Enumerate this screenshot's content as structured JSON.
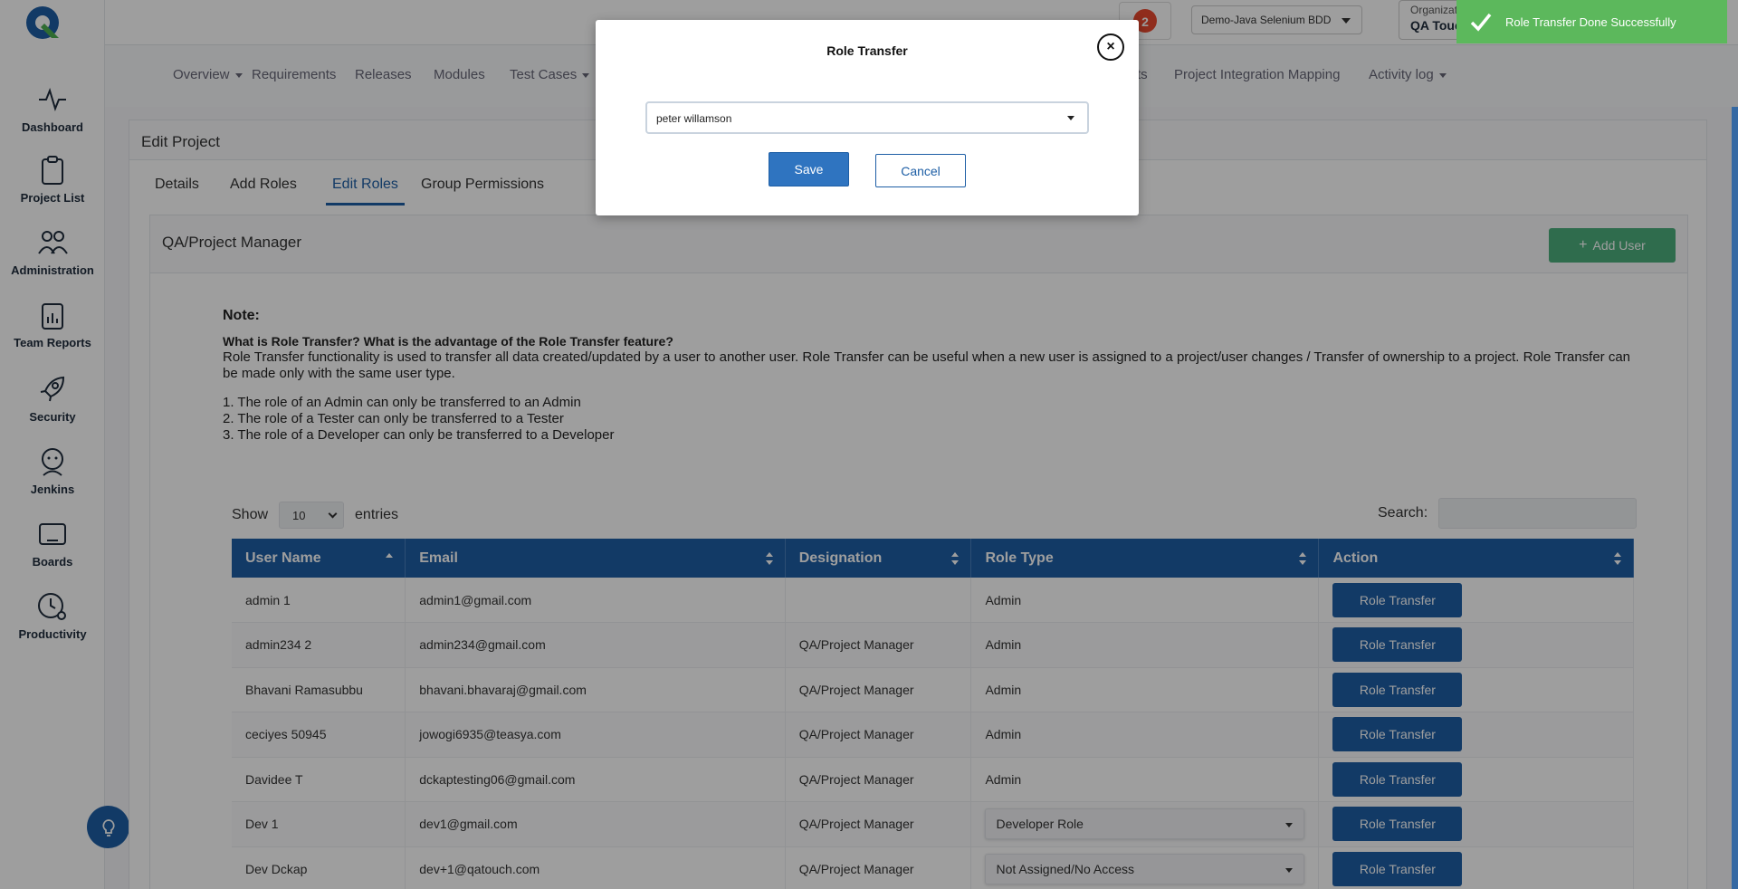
{
  "sidebar": {
    "items": [
      {
        "label": "Dashboard",
        "icon": "activity-icon"
      },
      {
        "label": "Project List",
        "icon": "clipboard-icon"
      },
      {
        "label": "Administration",
        "icon": "users-icon"
      },
      {
        "label": "Team Reports",
        "icon": "report-icon"
      },
      {
        "label": "Security",
        "icon": "rocket-icon"
      },
      {
        "label": "Jenkins",
        "icon": "jenkins-icon"
      },
      {
        "label": "Boards",
        "icon": "board-icon"
      },
      {
        "label": "Productivity",
        "icon": "clock-gear-icon"
      }
    ]
  },
  "topbar": {
    "g2_badge": "2",
    "project_select": "Demo-Java Selenium BDD",
    "org_label": "Organization",
    "org_name": "QA Touch Demo",
    "toast": "Role Transfer Done Successfully"
  },
  "nav": {
    "items": [
      "Overview",
      "Requirements",
      "Releases",
      "Modules",
      "Test Cases",
      "ts",
      "Project Integration Mapping",
      "Activity log"
    ]
  },
  "page": {
    "title": "Edit Project",
    "tabs": [
      "Details",
      "Add Roles",
      "Edit Roles",
      "Group Permissions"
    ],
    "active_tab": "Edit Roles",
    "section_title": "QA/Project Manager",
    "add_user": "Add User"
  },
  "note": {
    "heading": "Note:",
    "question": "What is Role Transfer? What is the advantage of the Role Transfer feature?",
    "body": "Role Transfer functionality is used to transfer all data created/updated by a user to another user. Role Transfer can be useful when a new user is assigned to a project/user changes / Transfer of ownership to a project. Role Transfer can be made only with the same user type.",
    "rules": [
      "1. The role of an Admin can only be transferred to an Admin",
      "2. The role of a Tester can only be transferred to a Tester",
      "3. The role of a Developer can only be transferred to a Developer"
    ]
  },
  "table_controls": {
    "show": "Show",
    "entries_value": "10",
    "entries": "entries",
    "search": "Search:"
  },
  "table": {
    "columns": [
      "User Name",
      "Email",
      "Designation",
      "Role Type",
      "Action"
    ],
    "rows": [
      {
        "user": "admin 1",
        "email": "admin1@gmail.com",
        "designation": "",
        "role": "Admin",
        "action": "Role Transfer"
      },
      {
        "user": "admin234 2",
        "email": "admin234@gmail.com",
        "designation": "QA/Project Manager",
        "role": "Admin",
        "action": "Role Transfer"
      },
      {
        "user": "Bhavani Ramasubbu",
        "email": "bhavani.bhavaraj@gmail.com",
        "designation": "QA/Project Manager",
        "role": "Admin",
        "action": "Role Transfer"
      },
      {
        "user": "ceciyes 50945",
        "email": "jowogi6935@teasya.com",
        "designation": "QA/Project Manager",
        "role": "Admin",
        "action": "Role Transfer"
      },
      {
        "user": "Davidee T",
        "email": "dckaptesting06@gmail.com",
        "designation": "QA/Project Manager",
        "role": "Admin",
        "action": "Role Transfer"
      },
      {
        "user": "Dev 1",
        "email": "dev1@gmail.com",
        "designation": "QA/Project Manager",
        "role": "Developer Role",
        "action": "Role Transfer"
      },
      {
        "user": "Dev Dckap",
        "email": "dev+1@qatouch.com",
        "designation": "QA/Project Manager",
        "role": "Not Assigned/No Access",
        "action": "Role Transfer"
      }
    ]
  },
  "modal": {
    "title": "Role Transfer",
    "selected_user": "peter willamson",
    "save": "Save",
    "cancel": "Cancel",
    "close": "×"
  }
}
